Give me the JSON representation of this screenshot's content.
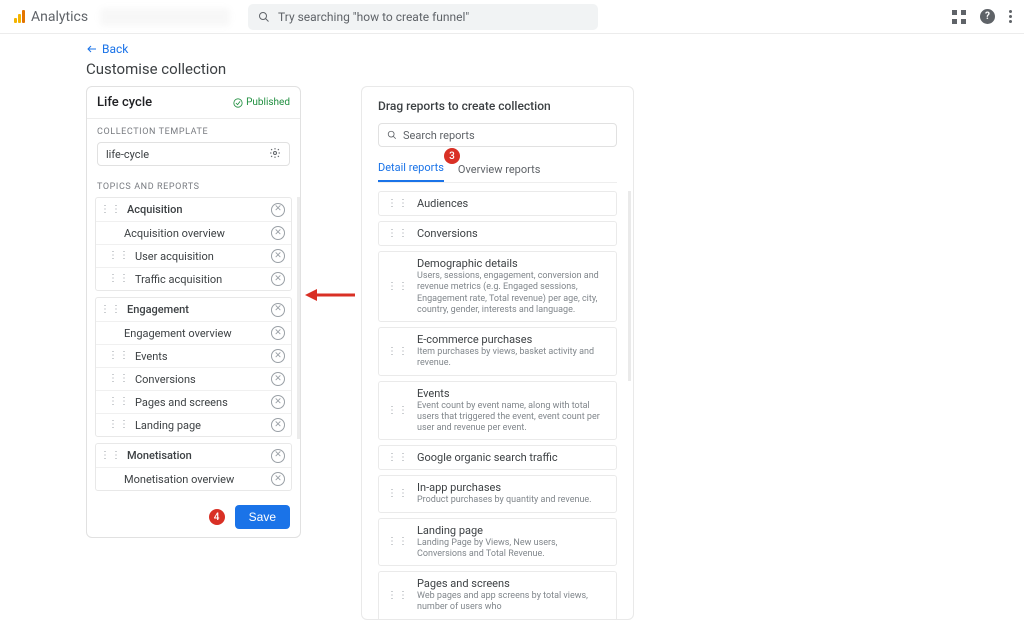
{
  "header": {
    "brand": "Analytics",
    "search_placeholder": "Try searching \"how to create funnel\""
  },
  "back_label": "Back",
  "page_title": "Customise collection",
  "left": {
    "name": "Life cycle",
    "status": "Published",
    "template_label": "COLLECTION TEMPLATE",
    "template_value": "life-cycle",
    "topics_label": "TOPICS AND REPORTS",
    "topics": [
      {
        "name": "Acquisition",
        "children": [
          "Acquisition overview",
          "User acquisition",
          "Traffic acquisition"
        ]
      },
      {
        "name": "Engagement",
        "children": [
          "Engagement overview",
          "Events",
          "Conversions",
          "Pages and screens",
          "Landing page"
        ]
      },
      {
        "name": "Monetisation",
        "children": [
          "Monetisation overview"
        ]
      }
    ],
    "save_label": "Save",
    "save_annotation": "4"
  },
  "right": {
    "title": "Drag reports to create collection",
    "search_placeholder": "Search reports",
    "tab_detail": "Detail reports",
    "tab_overview": "Overview reports",
    "tab_annotation": "3",
    "items": [
      {
        "name": "Audiences"
      },
      {
        "name": "Conversions"
      },
      {
        "name": "Demographic details",
        "desc": "Users, sessions, engagement, conversion and revenue metrics (e.g. Engaged sessions, Engagement rate, Total revenue) per age, city, country, gender, interests and language."
      },
      {
        "name": "E-commerce purchases",
        "desc": "Item purchases by views, basket activity and revenue."
      },
      {
        "name": "Events",
        "desc": "Event count by event name, along with total users that triggered the event, event count per user and revenue per event."
      },
      {
        "name": "Google organic search traffic"
      },
      {
        "name": "In-app purchases",
        "desc": "Product purchases by quantity and revenue."
      },
      {
        "name": "Landing page",
        "desc": "Landing Page by Views, New users, Conversions and Total Revenue."
      },
      {
        "name": "Pages and screens",
        "desc": "Web pages and app screens by total views, number of users who"
      }
    ]
  }
}
